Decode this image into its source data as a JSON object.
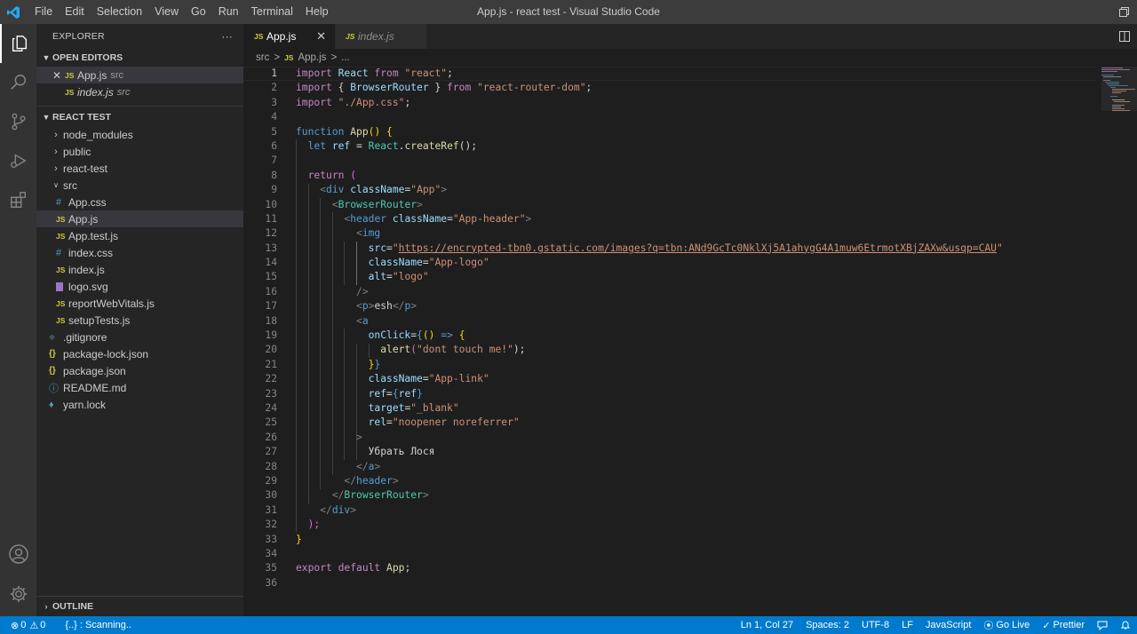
{
  "titlebar": {
    "menu": [
      "File",
      "Edit",
      "Selection",
      "View",
      "Go",
      "Run",
      "Terminal",
      "Help"
    ],
    "title": "App.js - react test - Visual Studio Code"
  },
  "sidebar": {
    "explorer_label": "EXPLORER",
    "more_label": "···",
    "open_editors_label": "OPEN EDITORS",
    "open_editors": [
      {
        "name": "App.js",
        "folder": "src",
        "badge": "JS"
      },
      {
        "name": "index.js",
        "folder": "src",
        "badge": "JS"
      }
    ],
    "project_label": "REACT TEST",
    "folders": [
      "node_modules",
      "public",
      "react-test",
      "src"
    ],
    "src_files": [
      {
        "name": "App.css",
        "badge": "#"
      },
      {
        "name": "App.js",
        "badge": "JS"
      },
      {
        "name": "App.test.js",
        "badge": "JS"
      },
      {
        "name": "index.css",
        "badge": "#"
      },
      {
        "name": "index.js",
        "badge": "JS"
      },
      {
        "name": "logo.svg",
        "badge": ""
      },
      {
        "name": "reportWebVitals.js",
        "badge": "JS"
      },
      {
        "name": "setupTests.js",
        "badge": "JS"
      }
    ],
    "root_files": [
      {
        "name": ".gitignore",
        "badge": "◆"
      },
      {
        "name": "package-lock.json",
        "badge": "{}"
      },
      {
        "name": "package.json",
        "badge": "{}"
      },
      {
        "name": "README.md",
        "badge": "ⓘ"
      },
      {
        "name": "yarn.lock",
        "badge": "♦"
      }
    ],
    "outline_label": "OUTLINE"
  },
  "tabs": [
    {
      "badge": "JS",
      "label": "App.js",
      "close": "✕"
    },
    {
      "badge": "JS",
      "label": "index.js"
    }
  ],
  "breadcrumb": [
    "src",
    ">",
    "JS",
    "App.js",
    ">",
    "..."
  ],
  "editor": {
    "line_numbers": [
      "1",
      "2",
      "3",
      "4",
      "5",
      "6",
      "7",
      "8",
      "9",
      "10",
      "11",
      "12",
      "13",
      "14",
      "15",
      "16",
      "17",
      "18",
      "19",
      "20",
      "21",
      "22",
      "23",
      "24",
      "25",
      "26",
      "27",
      "28",
      "29",
      "30",
      "31",
      "32",
      "33",
      "34",
      "35",
      "36"
    ],
    "current_line": 1,
    "tokens": {
      "l1_import": "import",
      "l1_react": " React ",
      "l1_from": "from",
      "l1_src": " \"react\"",
      "l1_end": ";",
      "l2_import": "import",
      "l2_open": " { ",
      "l2_br": "BrowserRouter",
      "l2_close": " } ",
      "l2_from": "from",
      "l2_src": " \"react-router-dom\"",
      "l2_end": ";",
      "l3_import": "import",
      "l3_src": " \"./App.css\"",
      "l3_end": ";",
      "l5_function": "function",
      "l5_app": " App",
      "l5_rest": "() {",
      "l6_let": "let",
      "l6_ref": " ref",
      "l6_eq": " = ",
      "l6_react": "React",
      "l6_dot": ".",
      "l6_create": "createRef",
      "l6_end": "();",
      "l8_return": "return",
      "l8_paren": " (",
      "l9_open": "<",
      "l9_div": "div",
      "l9_attr": " className",
      "l9_eq": "=",
      "l9_val": "\"App\"",
      "l9_close": ">",
      "l10_open": "<",
      "l10_tag": "BrowserRouter",
      "l10_close": ">",
      "l11_open": "<",
      "l11_tag": "header",
      "l11_attr": " className",
      "l11_eq": "=",
      "l11_val": "\"App-header\"",
      "l11_close": ">",
      "l12_open": "<",
      "l12_tag": "img",
      "l13_attr": "src",
      "l13_eq": "=",
      "l13_q1": "\"",
      "l13_url": "https://encrypted-tbn0.gstatic.com/images?q=tbn:ANd9GcTc0NklXj5A1ahygG4A1muw6EtrmotXBjZAXw&usqp=CAU",
      "l13_q2": "\"",
      "l14_attr": "className",
      "l14_eq": "=",
      "l14_val": "\"App-logo\"",
      "l15_attr": "alt",
      "l15_eq": "=",
      "l15_val": "\"logo\"",
      "l16_close": "/>",
      "l17_o1": "<",
      "l17_p1": "p",
      "l17_c1": ">",
      "l17_text": "esh",
      "l17_o2": "</",
      "l17_p2": "p",
      "l17_c2": ">",
      "l18_open": "<",
      "l18_tag": "a",
      "l19_attr": "onClick",
      "l19_eq": "=",
      "l19_brace": "{",
      "l19_paren": "()",
      "l19_arrow": " => ",
      "l19_b2": "{",
      "l20_alert": "alert",
      "l20_p1": "(",
      "l20_str": "\"dont touch me!\"",
      "l20_end": ");",
      "l21_b1": "}",
      "l21_b2": "}",
      "l22_attr": "className",
      "l22_eq": "=",
      "l22_val": "\"App-link\"",
      "l23_attr": "ref",
      "l23_eq": "=",
      "l23_b1": "{",
      "l23_val": "ref",
      "l23_b2": "}",
      "l24_attr": "target",
      "l24_eq": "=",
      "l24_val": "\"_blank\"",
      "l25_attr": "rel",
      "l25_eq": "=",
      "l25_val": "\"noopener noreferrer\"",
      "l26_close": ">",
      "l27_text": "Убрать Лося",
      "l28_open": "</",
      "l28_tag": "a",
      "l28_close": ">",
      "l29_open": "</",
      "l29_tag": "header",
      "l29_close": ">",
      "l30_open": "</",
      "l30_tag": "BrowserRouter",
      "l30_close": ">",
      "l31_open": "</",
      "l31_tag": "div",
      "l31_close": ">",
      "l32_end": ");",
      "l33_end": "}",
      "l35_export": "export",
      "l35_default": " default",
      "l35_app": " App",
      "l35_end": ";"
    }
  },
  "statusbar": {
    "errors": "0",
    "warnings": "0",
    "scanning": "{..} : Scanning..",
    "position": "Ln 1, Col 27",
    "spaces": "Spaces: 2",
    "encoding": "UTF-8",
    "eol": "LF",
    "language": "JavaScript",
    "golive": "Go Live",
    "prettier": "Prettier"
  },
  "colors": {
    "status_bg": "#007acc",
    "editor_bg": "#1e1e1e",
    "sidebar_bg": "#252526",
    "activity_bg": "#333333"
  }
}
